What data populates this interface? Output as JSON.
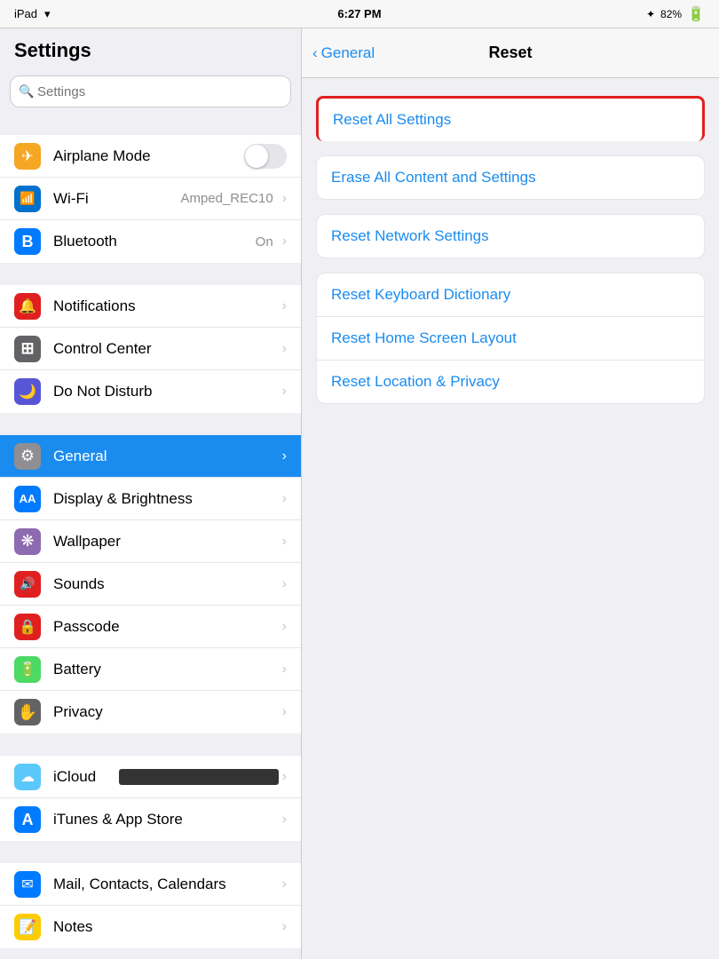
{
  "statusBar": {
    "left": "iPad",
    "wifi": "wifi",
    "time": "6:27 PM",
    "bluetooth": "82%",
    "battery": "82%"
  },
  "sidebar": {
    "title": "Settings",
    "search": {
      "placeholder": "Settings"
    },
    "groups": [
      {
        "items": [
          {
            "id": "airplane",
            "label": "Airplane Mode",
            "icon": "✈",
            "iconBg": "#f5a623",
            "type": "toggle",
            "value": ""
          },
          {
            "id": "wifi",
            "label": "Wi-Fi",
            "icon": "📶",
            "iconBg": "#0070cc",
            "type": "value",
            "value": "Amped_REC10"
          },
          {
            "id": "bluetooth",
            "label": "Bluetooth",
            "icon": "B",
            "iconBg": "#007aff",
            "type": "value",
            "value": "On"
          }
        ]
      },
      {
        "items": [
          {
            "id": "notifications",
            "label": "Notifications",
            "icon": "🔔",
            "iconBg": "#e02020",
            "type": "chevron"
          },
          {
            "id": "control-center",
            "label": "Control Center",
            "icon": "⊞",
            "iconBg": "#636366",
            "type": "chevron"
          },
          {
            "id": "do-not-disturb",
            "label": "Do Not Disturb",
            "icon": "🌙",
            "iconBg": "#5856d6",
            "type": "chevron"
          }
        ]
      },
      {
        "items": [
          {
            "id": "general",
            "label": "General",
            "icon": "⚙",
            "iconBg": "#8e8e93",
            "type": "chevron",
            "active": true
          },
          {
            "id": "display",
            "label": "Display & Brightness",
            "icon": "AA",
            "iconBg": "#007aff",
            "type": "chevron"
          },
          {
            "id": "wallpaper",
            "label": "Wallpaper",
            "icon": "❋",
            "iconBg": "#8e6ab0",
            "type": "chevron"
          },
          {
            "id": "sounds",
            "label": "Sounds",
            "icon": "🔊",
            "iconBg": "#e02020",
            "type": "chevron"
          },
          {
            "id": "passcode",
            "label": "Passcode",
            "icon": "🔒",
            "iconBg": "#e02020",
            "type": "chevron"
          },
          {
            "id": "battery",
            "label": "Battery",
            "icon": "🔋",
            "iconBg": "#4cd964",
            "type": "chevron"
          },
          {
            "id": "privacy",
            "label": "Privacy",
            "icon": "✋",
            "iconBg": "#636366",
            "type": "chevron"
          }
        ]
      },
      {
        "items": [
          {
            "id": "icloud",
            "label": "iCloud",
            "icon": "☁",
            "iconBg": "#5ac8fa",
            "type": "chevron",
            "redacted": true
          },
          {
            "id": "itunes",
            "label": "iTunes & App Store",
            "icon": "A",
            "iconBg": "#007aff",
            "type": "chevron"
          }
        ]
      },
      {
        "items": [
          {
            "id": "mail",
            "label": "Mail, Contacts, Calendars",
            "icon": "✉",
            "iconBg": "#007aff",
            "type": "chevron"
          },
          {
            "id": "notes",
            "label": "Notes",
            "icon": "📝",
            "iconBg": "#ffcc00",
            "type": "chevron"
          }
        ]
      }
    ]
  },
  "rightPanel": {
    "navBack": "General",
    "navTitle": "Reset",
    "groups": [
      {
        "items": [
          {
            "id": "reset-all",
            "label": "Reset All Settings",
            "highlighted": true
          }
        ]
      },
      {
        "items": [
          {
            "id": "erase-all",
            "label": "Erase All Content and Settings"
          }
        ]
      },
      {
        "items": [
          {
            "id": "reset-network",
            "label": "Reset Network Settings"
          }
        ]
      },
      {
        "items": [
          {
            "id": "reset-keyboard",
            "label": "Reset Keyboard Dictionary"
          },
          {
            "id": "reset-home",
            "label": "Reset Home Screen Layout"
          },
          {
            "id": "reset-location",
            "label": "Reset Location & Privacy"
          }
        ]
      }
    ]
  },
  "arrow": {
    "label": "→"
  }
}
